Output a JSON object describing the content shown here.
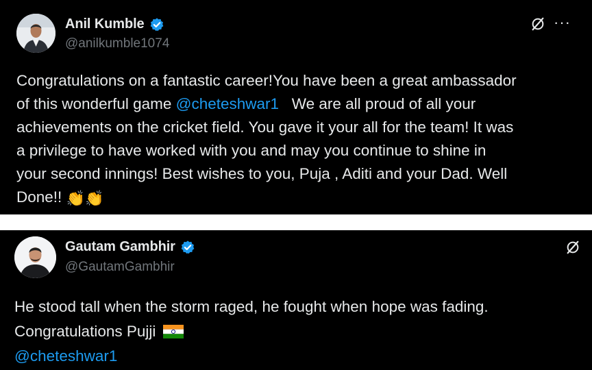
{
  "tweets": [
    {
      "author": "Anil Kumble",
      "handle": "@anilkumble1074",
      "lines": [
        {
          "parts": [
            {
              "t": "Congratulations on a fantastic career!You have been a great ambassador"
            }
          ]
        },
        {
          "parts": [
            {
              "t": "of this wonderful game "
            },
            {
              "t": "@cheteshwar1",
              "mention": true
            },
            {
              "t": "   We are all proud of all your"
            }
          ]
        },
        {
          "parts": [
            {
              "t": "achievements on the cricket field. You gave it your all for the team! It was"
            }
          ]
        },
        {
          "parts": [
            {
              "t": "a privilege to have worked with you and may you continue to shine in"
            }
          ]
        },
        {
          "parts": [
            {
              "t": "your second innings! Best wishes to you, Puja , Aditi and your Dad. Well"
            }
          ]
        },
        {
          "parts": [
            {
              "t": "Done!! "
            },
            {
              "t": "👏👏",
              "emoji": true
            }
          ]
        }
      ],
      "icons": {
        "verified": "verified-badge-icon",
        "grok": "grok-icon",
        "more": "more-icon"
      },
      "more_label": "···"
    },
    {
      "author": "Gautam Gambhir",
      "handle": "@GautamGambhir",
      "lines": [
        {
          "parts": [
            {
              "t": "He stood tall when the storm raged, he fought when hope was fading."
            }
          ]
        },
        {
          "parts": [
            {
              "t": "Congratulations Pujji "
            }
          ],
          "flag": "india-flag-icon"
        },
        {
          "parts": [
            {
              "t": "@cheteshwar1",
              "mention": true
            }
          ]
        }
      ],
      "icons": {
        "verified": "verified-badge-icon",
        "grok": "grok-icon"
      }
    }
  ],
  "colors": {
    "background": "#000000",
    "text": "#e7e9ea",
    "muted": "#71767b",
    "link": "#1d9bf0",
    "verified": "#1d9bf0",
    "separator": "#ffffff"
  }
}
